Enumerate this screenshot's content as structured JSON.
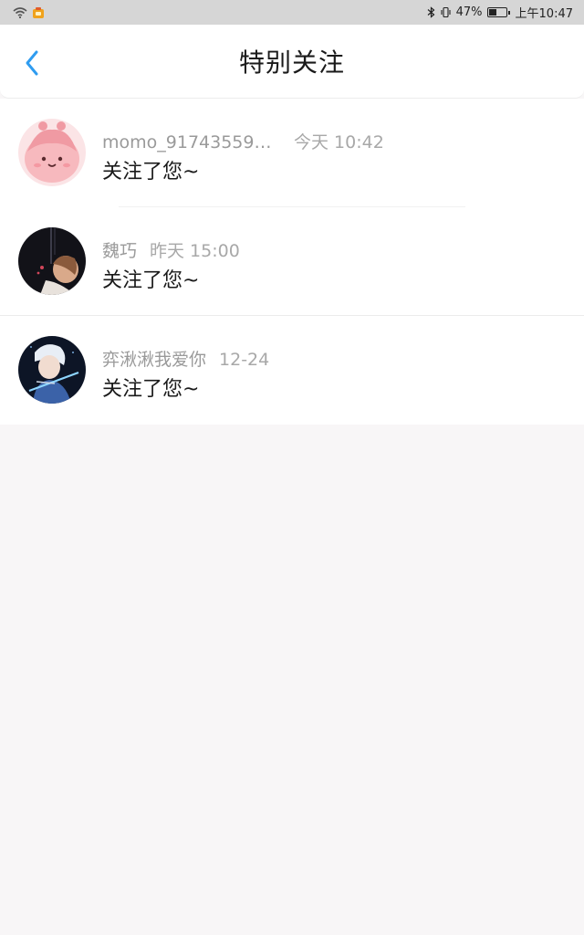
{
  "status_bar": {
    "left_icons": [
      "wifi-icon",
      "app-notification-icon"
    ],
    "battery_percent": "47%",
    "battery_level": 0.47,
    "time": "上午10:47"
  },
  "header": {
    "title": "特别关注",
    "back_icon": "chevron-left-icon",
    "accent_color": "#2f9cf0"
  },
  "follows": [
    {
      "name": "momo_917435593...",
      "time": "今天 10:42",
      "message": "关注了您~",
      "avatar": "pink-cartoon-avatar"
    },
    {
      "name": "魏巧",
      "time": "昨天 15:00",
      "message": "关注了您~",
      "avatar": "anime-girl-avatar"
    },
    {
      "name": "弈湫湫我爱你",
      "time": "12-24",
      "message": "关注了您~",
      "avatar": "anime-swordsman-avatar"
    }
  ]
}
